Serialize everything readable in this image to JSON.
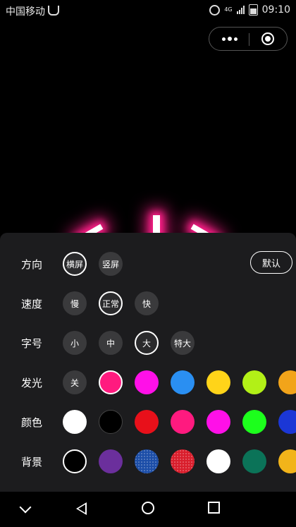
{
  "status": {
    "carrier": "中国移动",
    "network": "4G",
    "time": "09:10"
  },
  "capsule": {
    "more_icon": "more-dots-icon",
    "close_icon": "target-circle-icon"
  },
  "panel": {
    "default_label": "默认",
    "rows": [
      {
        "label": "方向",
        "options": [
          "横屏",
          "竖屏"
        ],
        "selected": "横屏"
      },
      {
        "label": "速度",
        "options": [
          "慢",
          "正常",
          "快"
        ],
        "selected": "正常"
      },
      {
        "label": "字号",
        "options": [
          "小",
          "中",
          "大",
          "特大"
        ],
        "selected": "大"
      },
      {
        "label": "发光",
        "off_label": "关",
        "colors": [
          "#ff1a7f",
          "#ff10e8",
          "#2a8ff2",
          "#ffd419",
          "#b2f017",
          "#f2a41a"
        ],
        "selected_index": 0
      },
      {
        "label": "颜色",
        "colors": [
          "#ffffff",
          "#000000",
          "#e8101a",
          "#ff1a7f",
          "#ff10e8",
          "#1cff1c",
          "#1b37d6"
        ],
        "selected_index": -1
      },
      {
        "label": "背景",
        "colors": [
          "#000000",
          "#6b2f9c",
          "#1c4ea8",
          "#d91e2c",
          "#ffffff",
          "#0b7358",
          "#f2b41a"
        ],
        "selected_index": 0
      }
    ]
  },
  "nav": {
    "icons": [
      "chevron-down-icon",
      "back-triangle-icon",
      "home-circle-icon",
      "recent-square-icon"
    ]
  }
}
